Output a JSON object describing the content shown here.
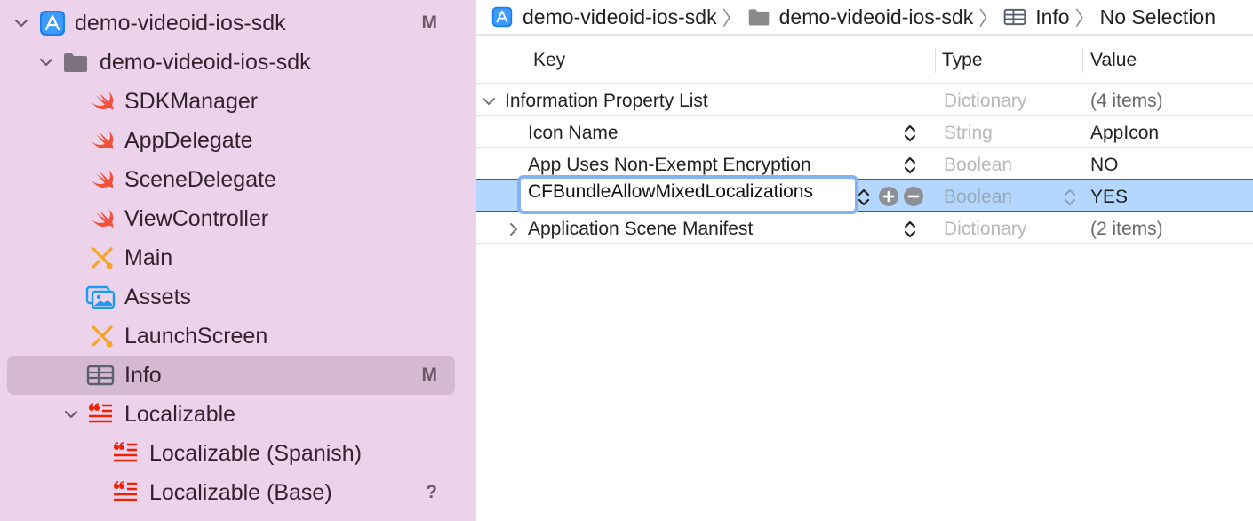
{
  "navigator": {
    "items": [
      {
        "label": "demo-videoid-ios-sdk",
        "icon": "xcode-project-icon",
        "expanded": true,
        "badge": "M"
      },
      {
        "label": "demo-videoid-ios-sdk",
        "icon": "folder-icon",
        "expanded": true
      },
      {
        "label": "SDKManager",
        "icon": "swift-file-icon"
      },
      {
        "label": "AppDelegate",
        "icon": "swift-file-icon"
      },
      {
        "label": "SceneDelegate",
        "icon": "swift-file-icon"
      },
      {
        "label": "ViewController",
        "icon": "swift-file-icon"
      },
      {
        "label": "Main",
        "icon": "storyboard-icon"
      },
      {
        "label": "Assets",
        "icon": "asset-catalog-icon"
      },
      {
        "label": "LaunchScreen",
        "icon": "storyboard-icon"
      },
      {
        "label": "Info",
        "icon": "plist-icon",
        "badge": "M",
        "selected": true
      },
      {
        "label": "Localizable",
        "icon": "strings-file-icon",
        "expanded": true
      },
      {
        "label": "Localizable (Spanish)",
        "icon": "strings-file-icon"
      },
      {
        "label": "Localizable (Base)",
        "icon": "strings-file-icon",
        "badge": "?"
      }
    ]
  },
  "jumpbar": {
    "crumbs": [
      {
        "label": "demo-videoid-ios-sdk",
        "icon": "xcode-project-icon"
      },
      {
        "label": "demo-videoid-ios-sdk",
        "icon": "folder-icon"
      },
      {
        "label": "Info",
        "icon": "plist-icon"
      },
      {
        "label": "No Selection"
      }
    ]
  },
  "plist": {
    "columns": {
      "key": "Key",
      "type": "Type",
      "value": "Value"
    },
    "rows": [
      {
        "key": "Information Property List",
        "type": "Dictionary",
        "value": "(4 items)",
        "expanded": true,
        "level": 0
      },
      {
        "key": "Icon Name",
        "type": "String",
        "value": "AppIcon",
        "level": 1
      },
      {
        "key": "App Uses Non-Exempt Encryption",
        "type": "Boolean",
        "value": "NO",
        "level": 1
      },
      {
        "key": "CFBundleAllowMixedLocalizations",
        "type": "Boolean",
        "value": "YES",
        "level": 1,
        "selected": true,
        "editing": true
      },
      {
        "key": "Application Scene Manifest",
        "type": "Dictionary",
        "value": "(2 items)",
        "level": 1,
        "expanded": false
      }
    ]
  },
  "colors": {
    "sidebar_bg": "#ecd2ea",
    "sidebar_selected": "#d5b8d1",
    "row_selected": "#b3d7ff",
    "row_selected_border": "#0a64d6",
    "swift_orange": "#f05138",
    "storyboard_yellow": "#f5a623",
    "strings_red": "#ee2200",
    "assets_blue": "#1a9cf0"
  }
}
